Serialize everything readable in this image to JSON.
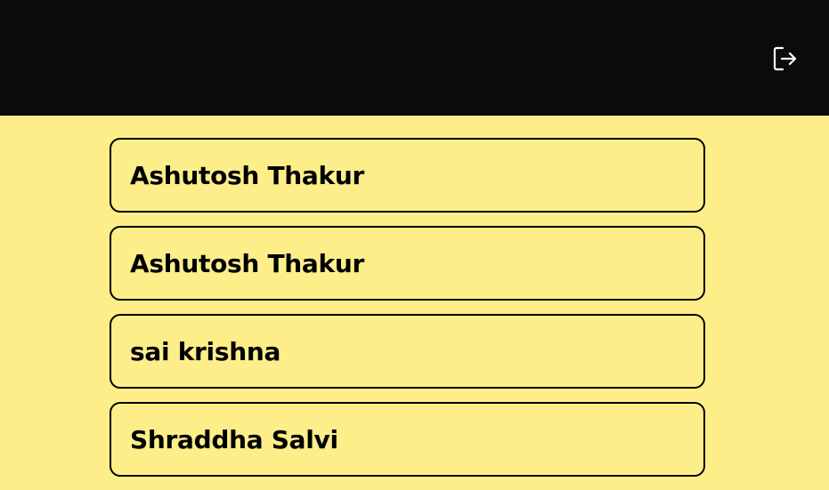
{
  "header": {
    "logout_icon": "logout-icon"
  },
  "colors": {
    "header_bg": "#0b0b0d",
    "page_bg": "#fdee8a",
    "card_border": "#000000"
  },
  "users": [
    {
      "name": "Ashutosh Thakur"
    },
    {
      "name": "Ashutosh Thakur"
    },
    {
      "name": "sai krishna"
    },
    {
      "name": "Shraddha Salvi"
    }
  ]
}
